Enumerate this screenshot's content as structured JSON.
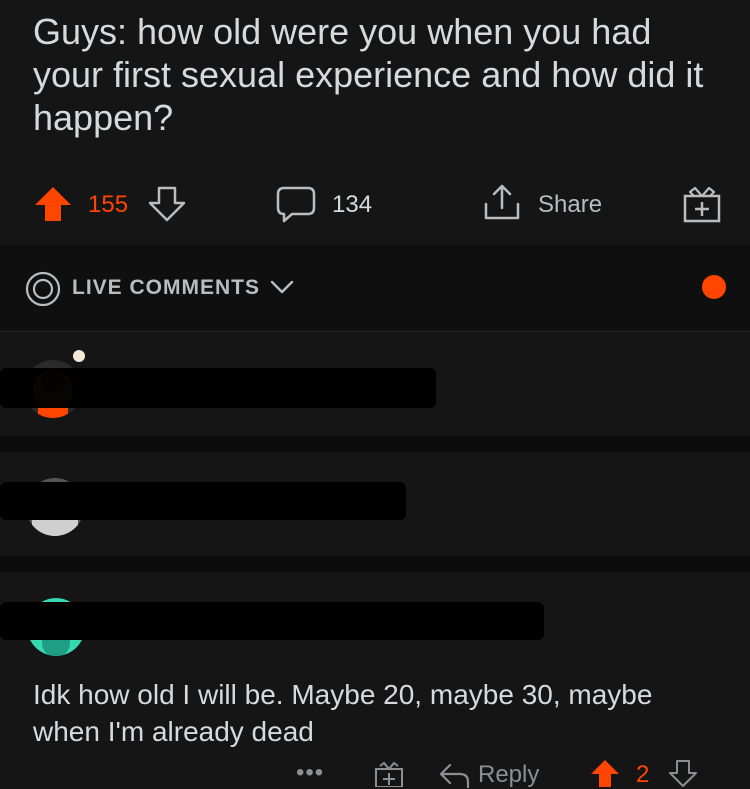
{
  "post": {
    "title": "Guys: how old were you when you had your first sexual experience and how did it happen?",
    "upvotes": "155",
    "comments": "134",
    "share_label": "Share"
  },
  "live": {
    "label": "LIVE COMMENTS"
  },
  "comment": {
    "text": "Idk how old I will be. Maybe 20, maybe 30, maybe when I'm already dead",
    "reply_label": "Reply",
    "score": "2",
    "more": "•••"
  },
  "colors": {
    "accent": "#ff4500",
    "background": "#151515",
    "text": "#d7dadc"
  }
}
